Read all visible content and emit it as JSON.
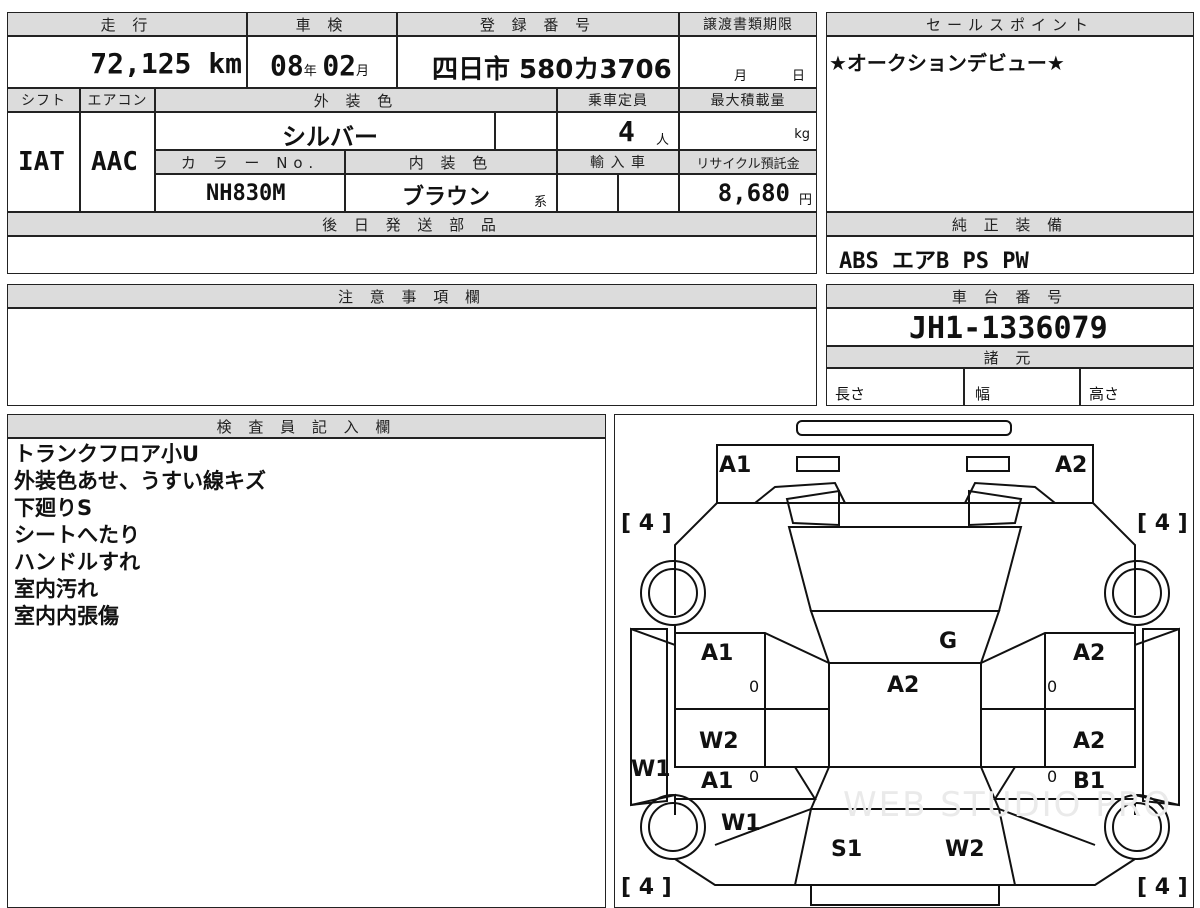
{
  "top_row": {
    "mileage": {
      "label": "走 行",
      "value": "72,125",
      "unit": "km"
    },
    "inspection": {
      "label": "車 検",
      "year": "08",
      "year_unit": "年",
      "month": "02",
      "month_unit": "月"
    },
    "registration": {
      "label": "登 録 番 号",
      "value": "四日市 580カ3706"
    },
    "transfer_deadline": {
      "label": "譲渡書類期限",
      "month_unit": "月",
      "day_unit": "日"
    }
  },
  "second_row": {
    "shift": {
      "label": "シフト",
      "value": "IAT"
    },
    "aircon": {
      "label": "エアコン",
      "value": "AAC"
    },
    "exterior_color": {
      "label": "外 装 色",
      "value": "シルバー"
    },
    "capacity": {
      "label": "乗車定員",
      "value": "4",
      "unit": "人"
    },
    "max_load": {
      "label": "最大積載量",
      "unit": "kg"
    },
    "color_no": {
      "label": "カ ラ ー No.",
      "value": "NH830M"
    },
    "interior_color": {
      "label": "内 装 色",
      "value": "ブラウン",
      "suffix": "系"
    },
    "import": {
      "label": "輸 入 車"
    },
    "recycle_fee": {
      "label": "リサイクル預託金",
      "value": "8,680",
      "unit": "円"
    }
  },
  "later_parts": {
    "label": "後 日 発 送 部 品"
  },
  "notes": {
    "label": "注 意 事 項 欄"
  },
  "sales_point": {
    "label": "セールスポイント",
    "value": "★オークションデビュー★"
  },
  "genuine_equipment": {
    "label": "純 正 装 備",
    "value": "ABS エアB PS PW"
  },
  "chassis": {
    "label": "車 台 番 号",
    "value": "JH1-1336079"
  },
  "specs": {
    "label": "諸 元",
    "length": "長さ",
    "width": "幅",
    "height": "高さ"
  },
  "inspector": {
    "label": "検 査 員 記 入 欄",
    "lines": [
      "トランクフロア小U",
      "外装色あせ、うすい線キズ",
      "下廻りS",
      "シートへたり",
      "ハンドルすれ",
      "室内汚れ",
      "室内内張傷"
    ]
  },
  "diagram": {
    "tire_left_front": "[ 4 ]",
    "tire_right_front": "[ 4 ]",
    "tire_left_rear": "[ 4 ]",
    "tire_right_rear": "[ 4 ]",
    "marks": {
      "front_left": "A1",
      "front_right": "A2",
      "windshield": "G",
      "roof": "A2",
      "left_front_door": "A1",
      "right_front_door": "A2",
      "left_rear_door_1": "W2",
      "left_rear_door_2": "A1",
      "right_rear_door_1": "A2",
      "right_rear_door_2": "B1",
      "left_sill": "W1",
      "left_rear_fender": "W1",
      "trunk_left": "S1",
      "trunk_right": "W2",
      "zero": "0"
    },
    "watermark": "WEB STUDIO PRO"
  }
}
